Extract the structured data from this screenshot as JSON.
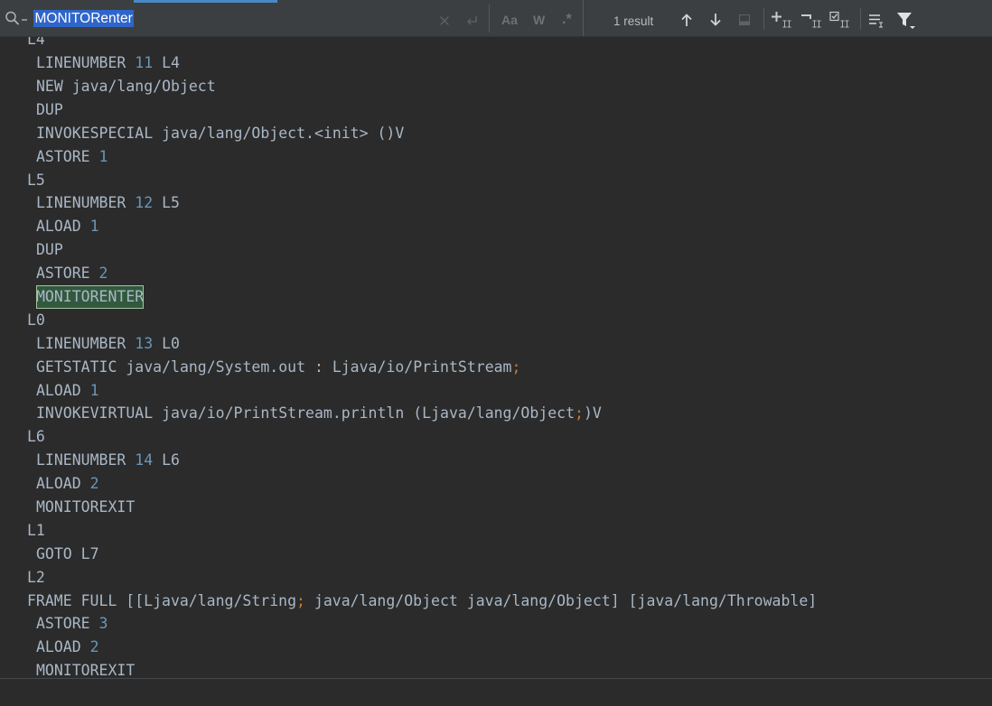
{
  "theme": {
    "editor_background": "#2b2b2b",
    "find_bar_background": "#3c3f41",
    "text": "#a9b7c6",
    "number": "#6897bb",
    "punctuation": "#cc7832",
    "search_match_background": "#32593d",
    "search_match_border": "#a4c49e",
    "query_selection": "#2f65ca",
    "accent": "#4a88c7"
  },
  "find_bar": {
    "query": "MONITORenter",
    "match_case_label": "Aa",
    "whole_words_label": "W",
    "regex_label": ".*",
    "result_count": "1 result",
    "field_icons": [
      "search-history-icon",
      "clear-icon",
      "new-line-icon"
    ],
    "navigation_icons": [
      "arrow-up-icon",
      "arrow-down-icon",
      "open-in-window-icon"
    ],
    "occurrence_icons": [
      "add-next-occurrence-icon",
      "unselect-occurrence-icon",
      "select-all-occurrences-icon"
    ],
    "filter_icons": [
      "search-in-selection-icon",
      "filter-funnel-icon"
    ]
  },
  "editor": {
    "lines": [
      {
        "label": "L4"
      },
      {
        "insn": [
          {
            "text": "LINENUMBER "
          },
          {
            "number": "11"
          },
          {
            "text": " L4"
          }
        ]
      },
      {
        "insn": [
          {
            "text": "NEW java/lang/Object"
          }
        ]
      },
      {
        "insn": [
          {
            "text": "DUP"
          }
        ]
      },
      {
        "insn": [
          {
            "text": "INVOKESPECIAL java/lang/Object.<init> ()V"
          }
        ]
      },
      {
        "insn": [
          {
            "text": "ASTORE "
          },
          {
            "number": "1"
          }
        ]
      },
      {
        "label": "L5"
      },
      {
        "insn": [
          {
            "text": "LINENUMBER "
          },
          {
            "number": "12"
          },
          {
            "text": " L5"
          }
        ]
      },
      {
        "insn": [
          {
            "text": "ALOAD "
          },
          {
            "number": "1"
          }
        ]
      },
      {
        "insn": [
          {
            "text": "DUP"
          }
        ]
      },
      {
        "insn": [
          {
            "text": "ASTORE "
          },
          {
            "number": "2"
          }
        ]
      },
      {
        "insn": [
          {
            "match": "MONITORENTER"
          }
        ]
      },
      {
        "label": "L0"
      },
      {
        "insn": [
          {
            "text": "LINENUMBER "
          },
          {
            "number": "13"
          },
          {
            "text": " L0"
          }
        ]
      },
      {
        "insn": [
          {
            "text": "GETSTATIC java/lang/System.out : Ljava/io/PrintStream"
          },
          {
            "punct": ";"
          }
        ]
      },
      {
        "insn": [
          {
            "text": "ALOAD "
          },
          {
            "number": "1"
          }
        ]
      },
      {
        "insn": [
          {
            "text": "INVOKEVIRTUAL java/io/PrintStream.println (Ljava/lang/Object"
          },
          {
            "punct": ";"
          },
          {
            "text": ")V"
          }
        ]
      },
      {
        "label": "L6"
      },
      {
        "insn": [
          {
            "text": "LINENUMBER "
          },
          {
            "number": "14"
          },
          {
            "text": " L6"
          }
        ]
      },
      {
        "insn": [
          {
            "text": "ALOAD "
          },
          {
            "number": "2"
          }
        ]
      },
      {
        "insn": [
          {
            "text": "MONITOREXIT"
          }
        ]
      },
      {
        "label": "L1"
      },
      {
        "insn": [
          {
            "text": "GOTO L7"
          }
        ]
      },
      {
        "label": "L2"
      },
      {
        "frame": [
          {
            "text": "FRAME FULL [[Ljava/lang/String"
          },
          {
            "punct": ";"
          },
          {
            "text": " java/lang/Object java/lang/Object] [java/lang/Throwable]"
          }
        ]
      },
      {
        "insn": [
          {
            "text": "ASTORE "
          },
          {
            "number": "3"
          }
        ]
      },
      {
        "insn": [
          {
            "text": "ALOAD "
          },
          {
            "number": "2"
          }
        ]
      },
      {
        "insn": [
          {
            "text": "MONITOREXIT"
          }
        ]
      }
    ]
  }
}
